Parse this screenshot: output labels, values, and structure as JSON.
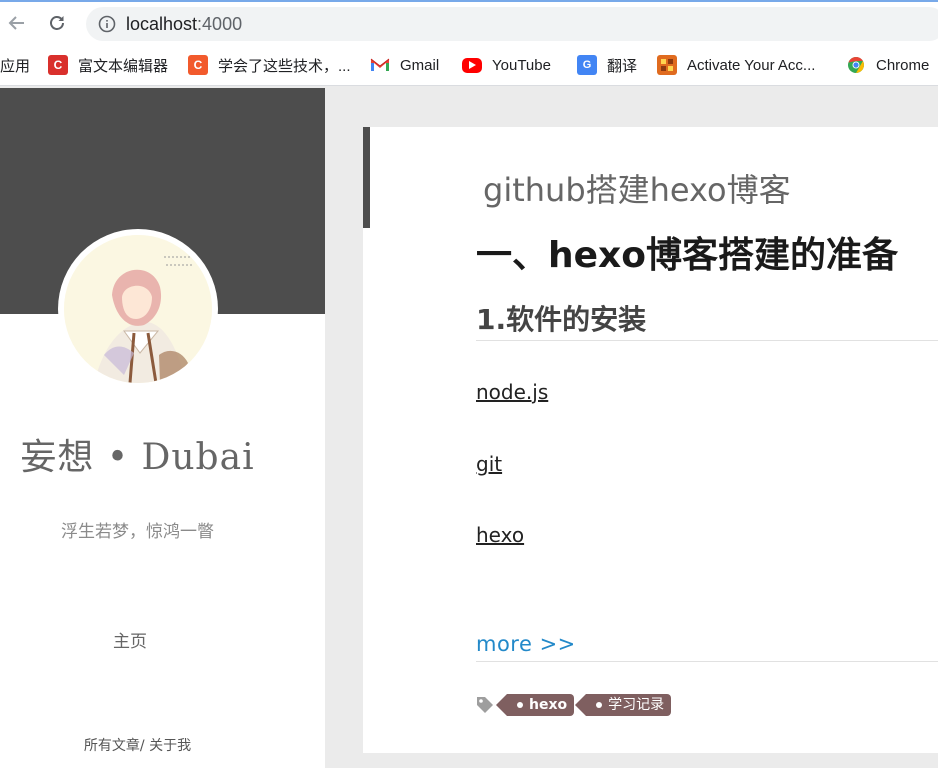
{
  "browser": {
    "url_host": "localhost",
    "url_port": ":4000",
    "bookmarks": [
      {
        "label": "应用",
        "icon": "apps-icon"
      },
      {
        "label": "富文本编辑器",
        "icon": "bookmark-c-red-icon",
        "color": "#d9302c"
      },
      {
        "label": "学会了这些技术，...",
        "icon": "bookmark-c-orange-icon",
        "color": "#f25a2c"
      },
      {
        "label": "Gmail",
        "icon": "gmail-icon"
      },
      {
        "label": "YouTube",
        "icon": "youtube-icon",
        "color": "#ff0000"
      },
      {
        "label": "翻译",
        "icon": "translate-icon",
        "color": "#4285f4"
      },
      {
        "label": "Activate Your Acc...",
        "icon": "activate-icon",
        "color": "#e06b1f"
      },
      {
        "label": "Chrome",
        "icon": "chrome-icon"
      }
    ]
  },
  "sidebar": {
    "site_title": "妄想 • Dubai",
    "subtitle": "浮生若梦，惊鸿一瞥",
    "nav_home": "主页",
    "nav_all_posts": "所有文章",
    "nav_sep": "/",
    "nav_about": "关于我"
  },
  "article": {
    "title": "github搭建hexo博客",
    "heading1": "一、hexo博客搭建的准备",
    "heading2": "1.软件的安装",
    "links": [
      "node.js",
      "git",
      "hexo"
    ],
    "more": "more >>",
    "tags": [
      "hexo",
      "学习记录"
    ]
  },
  "colors": {
    "banner": "#4d4d4d",
    "tag_bg": "#7f5f60",
    "more_link": "#2389c9"
  }
}
